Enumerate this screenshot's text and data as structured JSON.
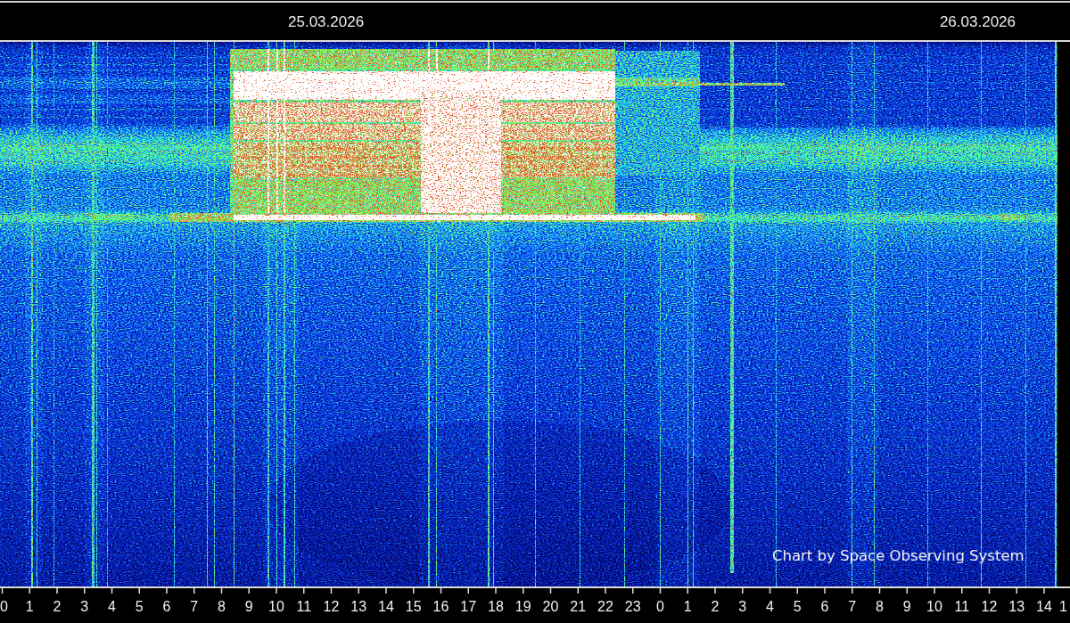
{
  "date_bar": {
    "dates": [
      "25.03.2026",
      "26.03.2026"
    ]
  },
  "spectrogram": {
    "credit": "Chart by Space Observing System"
  },
  "time_axis": {
    "labels": [
      "0",
      "1",
      "2",
      "3",
      "4",
      "5",
      "6",
      "7",
      "8",
      "9",
      "10",
      "11",
      "12",
      "13",
      "14",
      "15",
      "16",
      "17",
      "18",
      "19",
      "20",
      "21",
      "22",
      "23",
      "0",
      "1",
      "2",
      "3",
      "4",
      "5",
      "6",
      "7",
      "8",
      "9",
      "10",
      "11",
      "12",
      "13",
      "14",
      "1"
    ]
  }
}
